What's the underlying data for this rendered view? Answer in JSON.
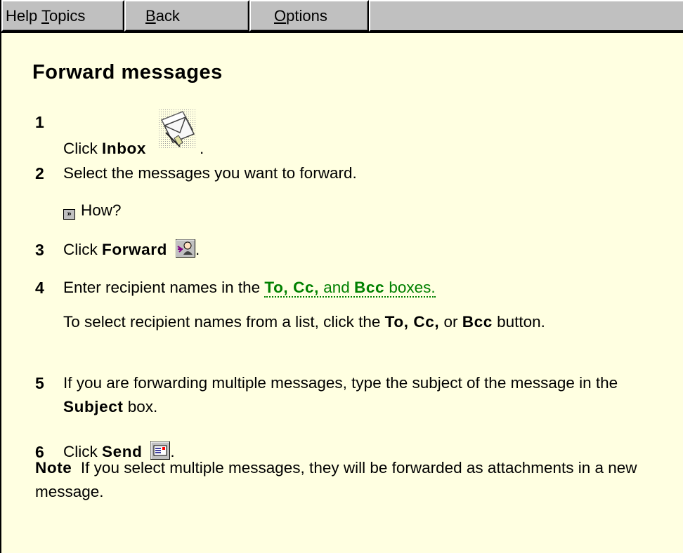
{
  "toolbar": {
    "help_topics_pre": "Help ",
    "help_topics_u": "T",
    "help_topics_post": "opics",
    "back_u": "B",
    "back_post": "ack",
    "options_u": "O",
    "options_post": "ptions"
  },
  "title": "Forward messages",
  "steps": [
    {
      "num": "1",
      "pre": "Click ",
      "bold": "Inbox",
      "post": "."
    },
    {
      "num": "2",
      "text": "Select the messages you want to forward."
    },
    {
      "num": "3",
      "pre": "Click ",
      "bold": "Forward",
      "post": "."
    },
    {
      "num": "4",
      "pre": "Enter recipient names in the ",
      "link_bold": "To, Cc,",
      "link_mid": " and ",
      "link_bold2": "Bcc",
      "link_post": " boxes."
    },
    {
      "num": "5",
      "pre": "If you are forwarding multiple messages, type the subject of the message in the ",
      "bold": "Subject",
      "post": " box."
    },
    {
      "num": "6",
      "pre": "Click ",
      "bold": "Send",
      "post": "."
    }
  ],
  "how_label": "How?",
  "step4_extra": {
    "pre": "To select recipient names from a list, click the ",
    "bold1": "To, Cc,",
    "mid": " or ",
    "bold2": "Bcc",
    "post": " button."
  },
  "note": {
    "label": "Note",
    "text": "If you select multiple messages, they will be forwarded as attachments in a new message."
  },
  "icons": {
    "inbox": "inbox-icon",
    "forward": "forward-icon",
    "send": "send-icon",
    "how": "jump-arrow-icon"
  },
  "colors": {
    "background": "#ffffe1",
    "toolbar": "#c0c0c0",
    "link": "#008000"
  }
}
